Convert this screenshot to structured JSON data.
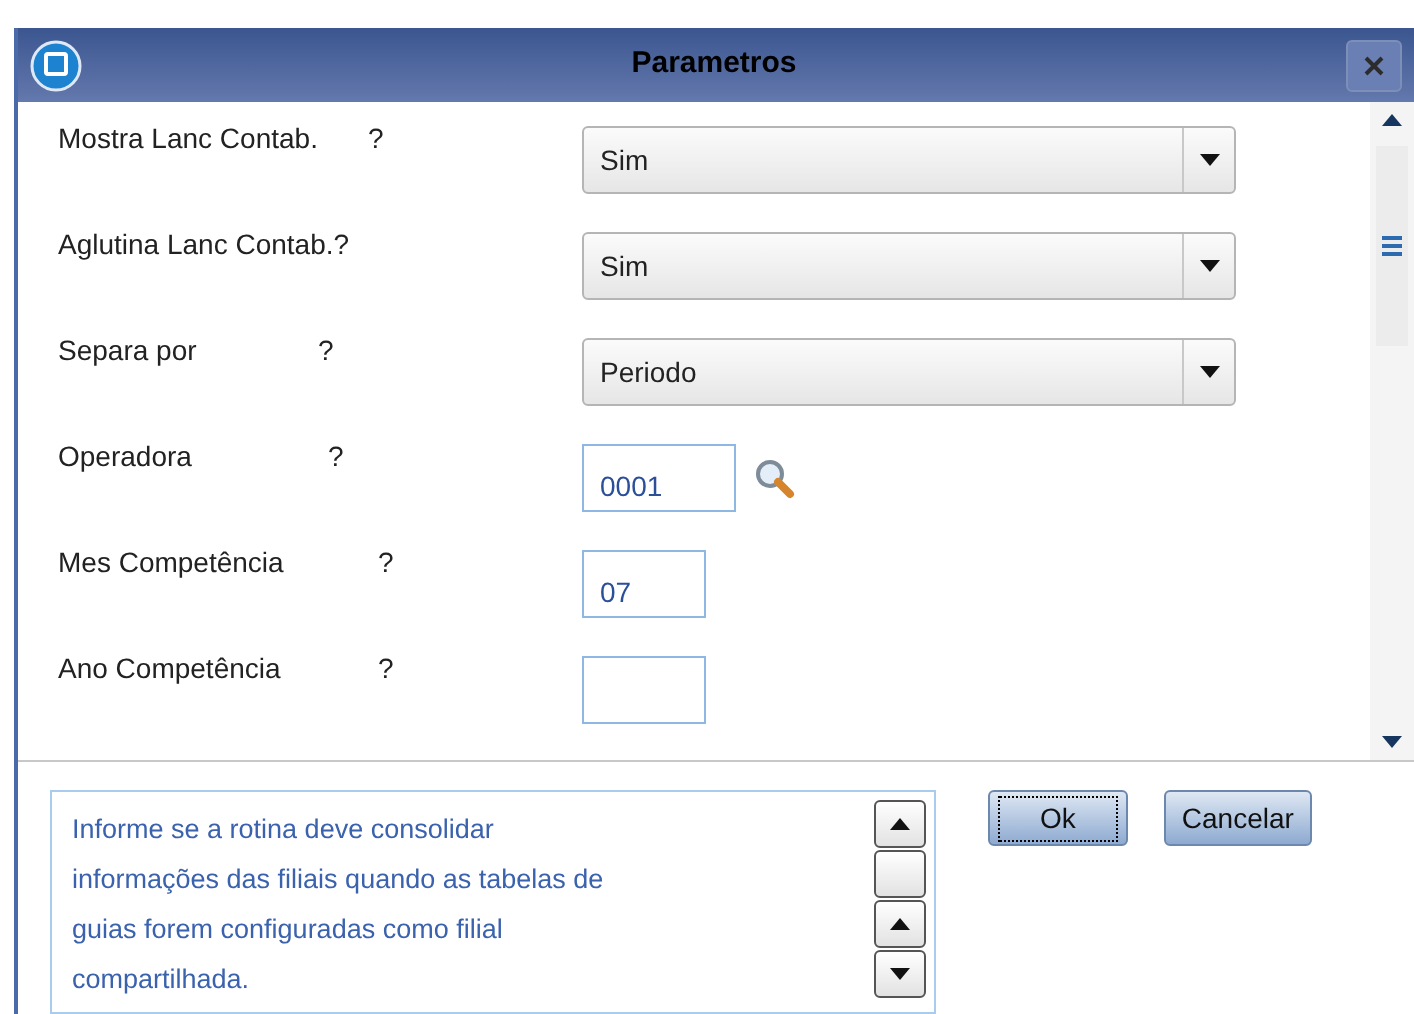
{
  "window": {
    "title": "Parametros"
  },
  "fields": [
    {
      "label": "Mostra Lanc Contab.",
      "help": "?",
      "kind": "select",
      "value": "Sim"
    },
    {
      "label": "Aglutina Lanc Contab.?",
      "kind": "select",
      "value": "Sim"
    },
    {
      "label": "Separa por",
      "help": "?",
      "kind": "select",
      "value": "Periodo"
    },
    {
      "label": "Operadora",
      "help": "?",
      "kind": "lookup",
      "value": "0001"
    },
    {
      "label": "Mes Competência",
      "help": "?",
      "kind": "text",
      "value": "07"
    },
    {
      "label": "Ano Competência",
      "help": "?",
      "kind": "text"
    }
  ],
  "help_text": "Informe se a rotina deve consolidar informações das filiais quando as tabelas de guias forem configuradas como filial compartilhada.",
  "buttons": [
    {
      "label": "Ok",
      "focused": true
    },
    {
      "label": "Cancelar",
      "focused": false
    }
  ]
}
